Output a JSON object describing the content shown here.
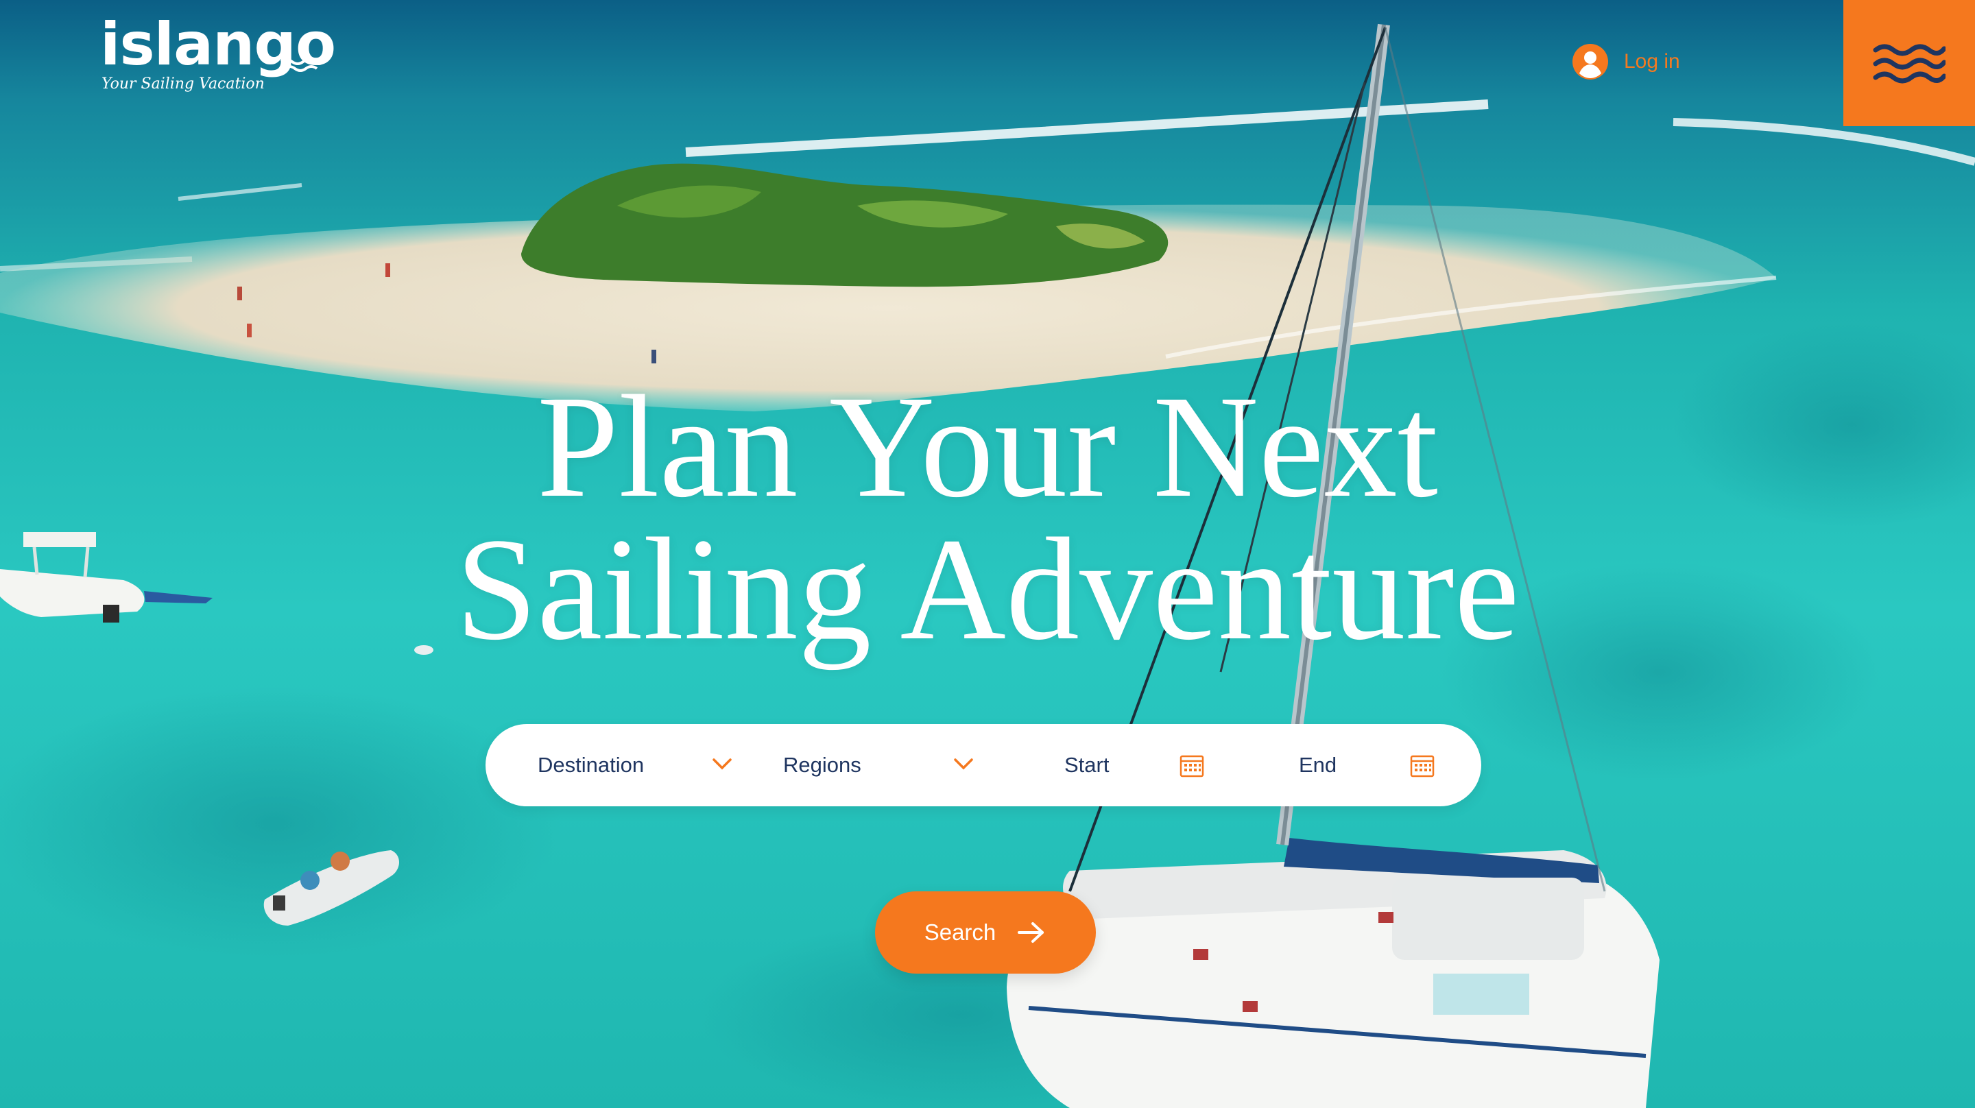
{
  "brand": {
    "name": "islango",
    "tagline": "Your Sailing Vacation",
    "accent_color": "#f5781e",
    "navy_color": "#1f3560"
  },
  "header": {
    "login_label": "Log in",
    "login_icon": "user-circle-icon",
    "menu_icon": "wave-menu-icon"
  },
  "hero": {
    "headline_line1": "Plan Your Next",
    "headline_line2": "Sailing Adventure",
    "background": "aerial view of a sandbar island, turquoise sea and a white catamaran"
  },
  "search": {
    "destination_label": "Destination",
    "regions_label": "Regions",
    "start_label": "Start",
    "end_label": "End",
    "dropdown_icon": "chevron-down-icon",
    "date_icon": "calendar-icon",
    "button_label": "Search",
    "button_icon": "arrow-right-icon"
  }
}
